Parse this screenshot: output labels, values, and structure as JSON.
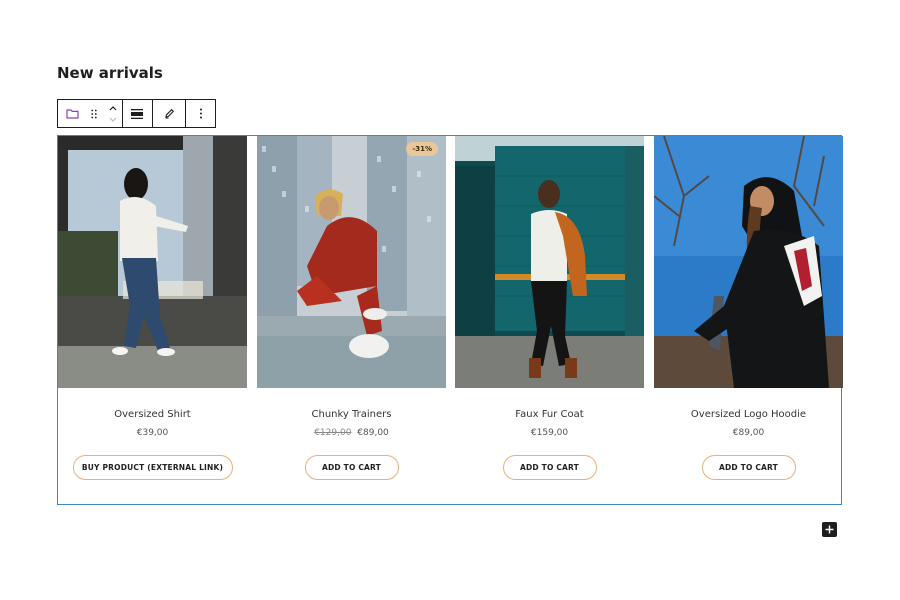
{
  "section": {
    "heading": "New arrivals"
  },
  "toolbar": {
    "buttons": [
      {
        "icon": "folder-icon"
      },
      {
        "icon": "drag-handle-icon"
      },
      {
        "icon": "move-up-down-icon"
      },
      {
        "icon": "align-icon"
      },
      {
        "icon": "pencil-icon"
      },
      {
        "icon": "more-options-icon"
      }
    ]
  },
  "products": [
    {
      "title": "Oversized Shirt",
      "price": "€39,00",
      "button": "BUY PRODUCT (EXTERNAL LINK)"
    },
    {
      "title": "Chunky Trainers",
      "old_price": "€129,00",
      "price": "€89,00",
      "badge": "-31%",
      "button": "ADD TO CART"
    },
    {
      "title": "Faux Fur Coat",
      "price": "€159,00",
      "button": "ADD TO CART"
    },
    {
      "title": "Oversized Logo Hoodie",
      "price": "€89,00",
      "button": "ADD TO CART"
    }
  ],
  "colors": {
    "block_border": "#3a86c8",
    "button_border": "#e8b07a",
    "badge_bg": "#e8c89a"
  }
}
